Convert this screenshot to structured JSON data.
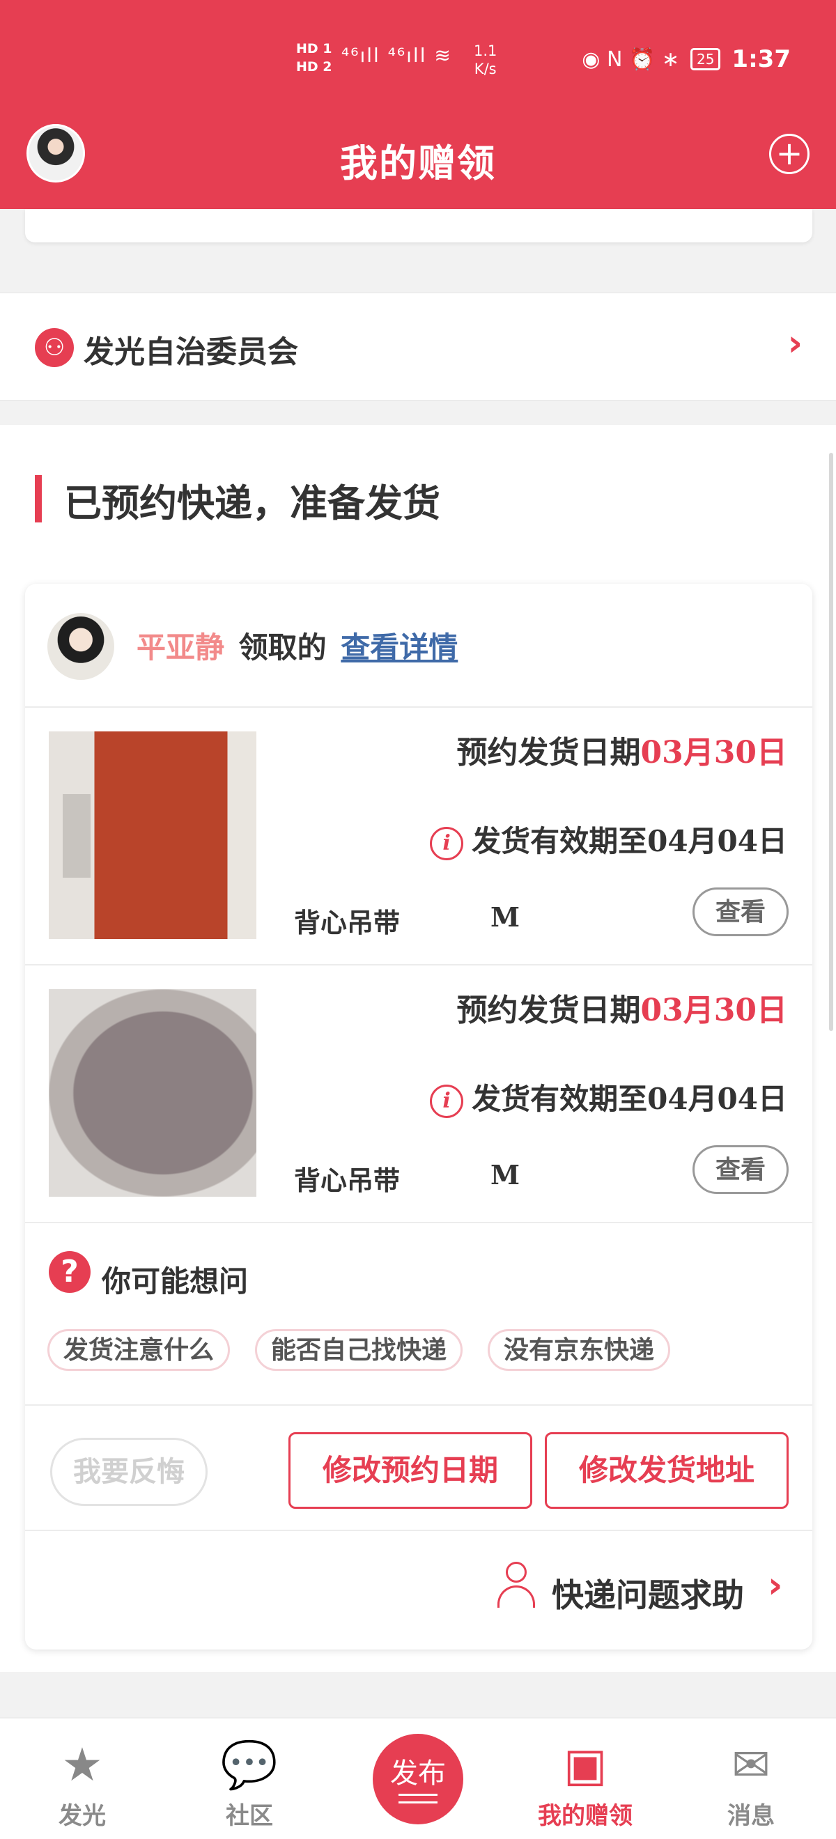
{
  "status_bar": {
    "hd": "HD 1\nHD 2",
    "network": "⁴⁶ıll ⁴⁶ıll ≋",
    "speed": "1.1\nK/s",
    "icons": "◉ N ⏰ ∗",
    "battery": "25",
    "time": "1:37"
  },
  "header": {
    "title": "我的赠领",
    "plus_icon": "+"
  },
  "committee": {
    "label": "发光自治委员会",
    "chevron": "›"
  },
  "section": {
    "title": "已预约快递，准备发货"
  },
  "claim": {
    "name": "平亚静",
    "verb": "领取的",
    "link": "查看详情"
  },
  "items": [
    {
      "date_label": "预约发货日期",
      "date": "03月30日",
      "valid": "发货有效期至04月04日",
      "type": "背心吊带",
      "size": "M",
      "view": "查看"
    },
    {
      "date_label": "预约发货日期",
      "date": "03月30日",
      "valid": "发货有效期至04月04日",
      "type": "背心吊带",
      "size": "M",
      "view": "查看"
    }
  ],
  "faq": {
    "icon": "?",
    "title": "你可能想问",
    "chips": [
      "发货注意什么",
      "能否自己找快递",
      "没有京东快递"
    ]
  },
  "actions": {
    "regret": "我要反悔",
    "change_date": "修改预约日期",
    "change_address": "修改发货地址"
  },
  "help": {
    "label": "快递问题求助",
    "chevron": "›"
  },
  "nav": {
    "items": [
      {
        "label": "发光",
        "icon": "★"
      },
      {
        "label": "社区",
        "icon": "💬"
      },
      {
        "label": "发布"
      },
      {
        "label": "我的赠领",
        "icon": "▣"
      },
      {
        "label": "消息",
        "icon": "✉"
      }
    ]
  },
  "colors": {
    "accent": "#e63e52"
  }
}
